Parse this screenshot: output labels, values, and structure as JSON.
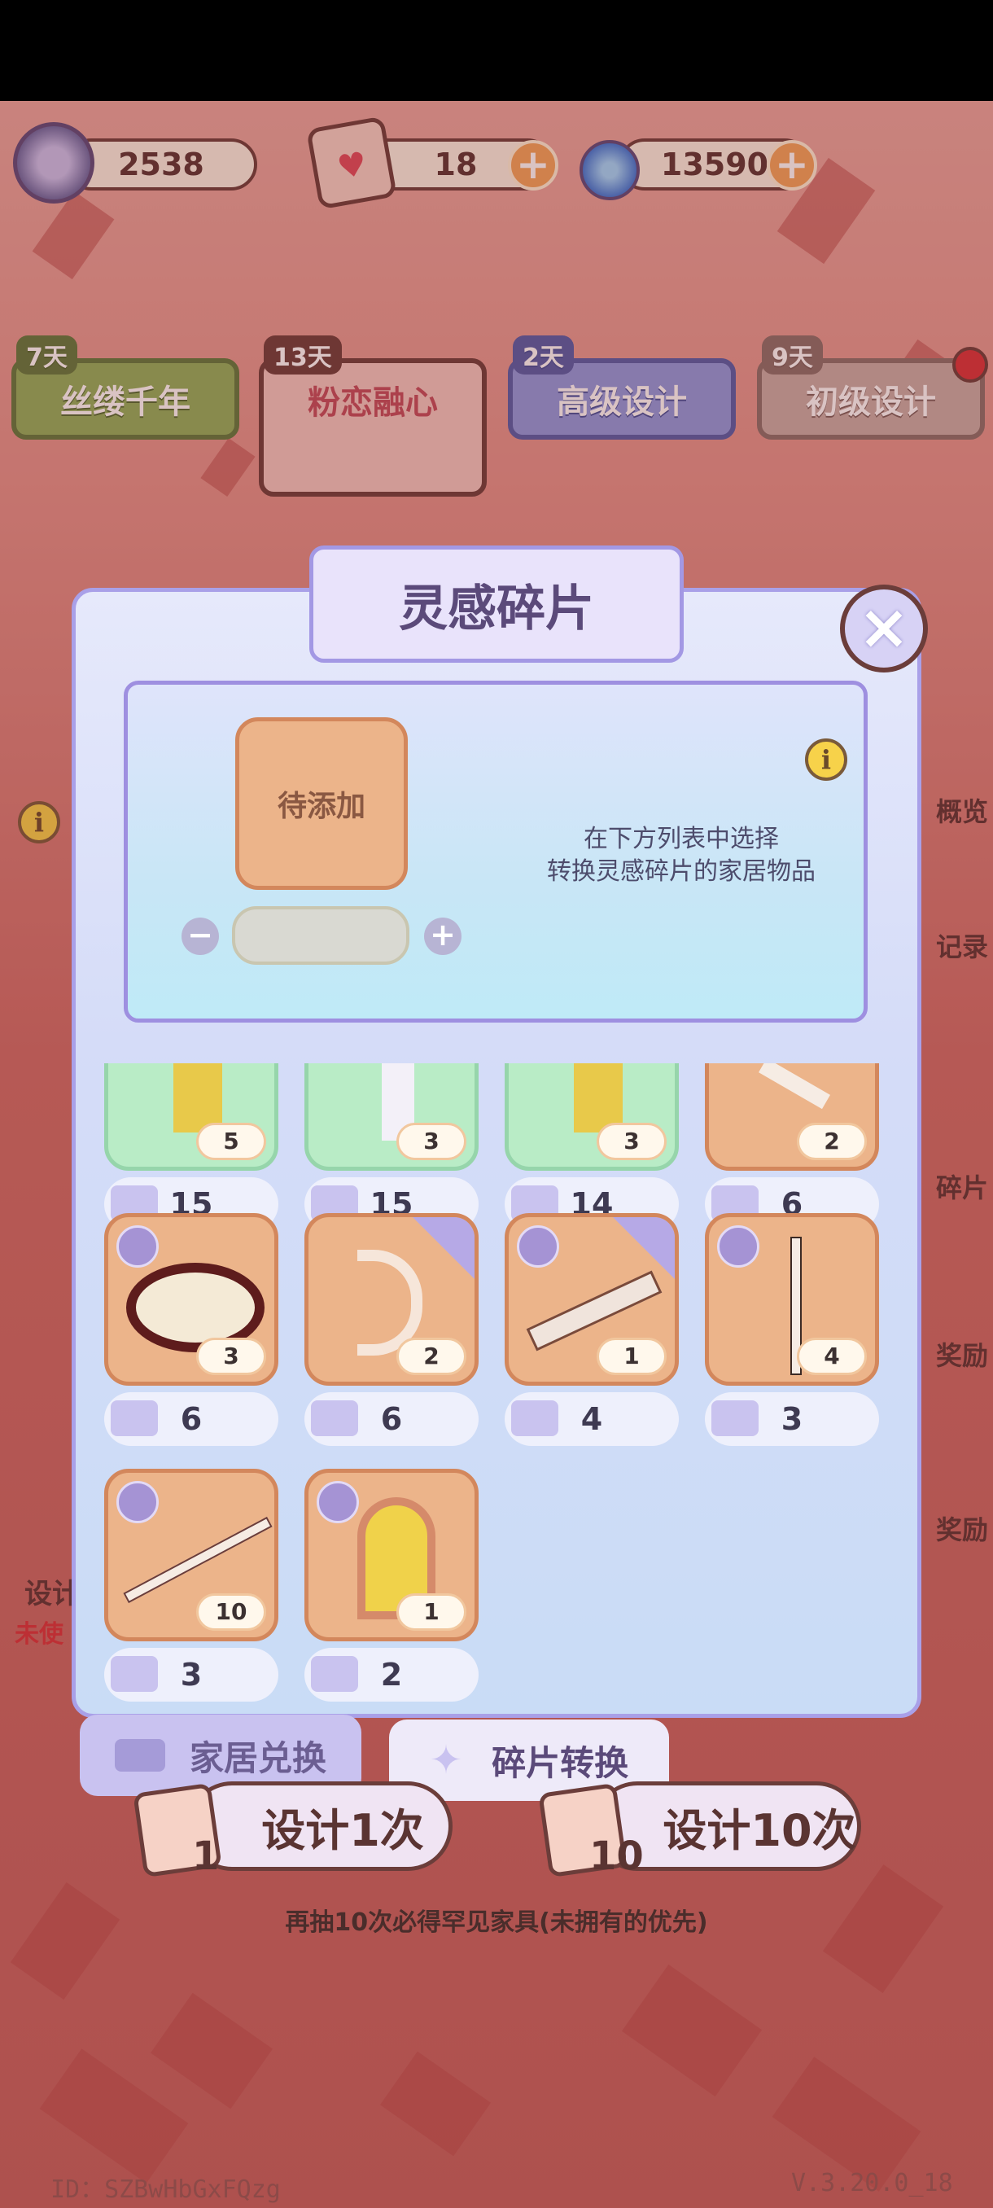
{
  "currencies": {
    "gem": "2538",
    "tickets": "18",
    "tickets_plus": "+",
    "swirl": "13590",
    "swirl_plus": "+"
  },
  "banners": [
    {
      "days": "7天",
      "name": "丝缕千年"
    },
    {
      "days": "13天",
      "name": "粉恋融心"
    },
    {
      "days": "2天",
      "name": "高级设计"
    },
    {
      "days": "9天",
      "name": "初级设计"
    }
  ],
  "side": {
    "overview": "概览",
    "record": "记录",
    "fragments": "碎片",
    "reward1": "奖励",
    "reward2": "奖励",
    "design": "设计",
    "unused": "未使"
  },
  "dialog": {
    "title": "灵感碎片",
    "close": "×",
    "slot_label": "待添加",
    "minus": "−",
    "plus": "+",
    "info": "i",
    "hint_line1": "在下方列表中选择",
    "hint_line2": "转换灵感碎片的家居物品"
  },
  "items": [
    {
      "count": "5",
      "cost": "15"
    },
    {
      "count": "3",
      "cost": "15"
    },
    {
      "count": "3",
      "cost": "14"
    },
    {
      "count": "2",
      "cost": "6"
    },
    {
      "count": "3",
      "cost": "6"
    },
    {
      "count": "2",
      "cost": "6"
    },
    {
      "count": "1",
      "cost": "4"
    },
    {
      "count": "4",
      "cost": "3"
    },
    {
      "count": "10",
      "cost": "3"
    },
    {
      "count": "1",
      "cost": "2"
    }
  ],
  "tabs": {
    "home_exchange": "家居兑换",
    "fragment_convert": "碎片转换"
  },
  "draw": {
    "once_label": "设计1次",
    "once_count": "1",
    "ten_label": "设计10次",
    "ten_count": "10",
    "pity_text": "再抽10次必得罕见家具(未拥有的优先)"
  },
  "footer": {
    "id": "ID：SZBwHbGxFQzg",
    "version": "V.3.20.0_18"
  },
  "colors": {
    "accent_purple": "#a398e4",
    "card_orange": "#ecb48a",
    "card_green": "#b9ecc6",
    "bg_red": "#c4625e"
  }
}
